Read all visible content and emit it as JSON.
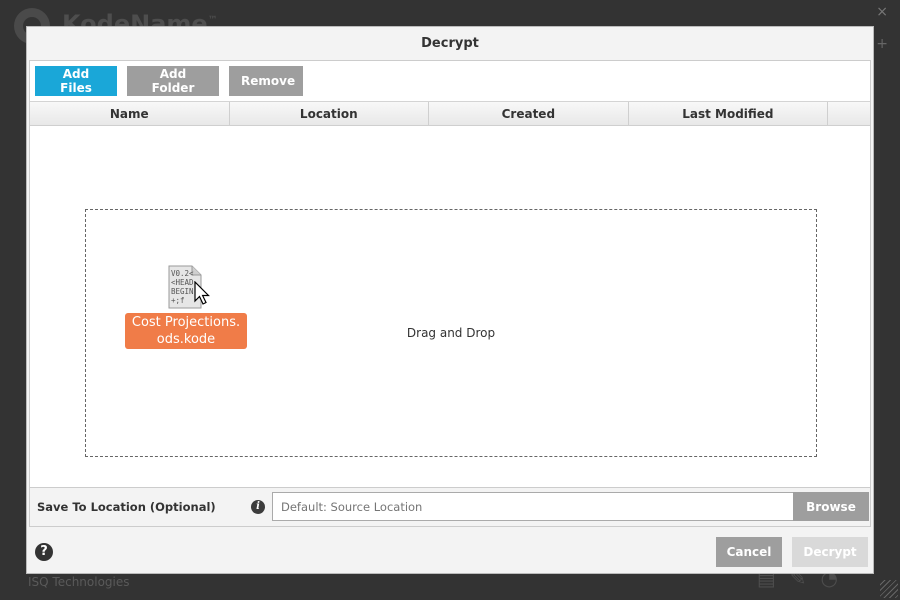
{
  "background": {
    "brand": "KodeName",
    "brand_mark": "™",
    "footer_text": "ISQ Technologies",
    "close_glyph": "×",
    "plus_glyph": "+"
  },
  "dialog": {
    "title": "Decrypt",
    "toolbar": {
      "add_files": "Add Files",
      "add_folder": "Add Folder",
      "remove": "Remove"
    },
    "table": {
      "columns": [
        "Name",
        "Location",
        "Created",
        "Last Modified"
      ]
    },
    "drop_zone": {
      "text": "Drag and Drop",
      "dragged_file": {
        "name_line1": "Cost Projections.",
        "name_line2": "ods.kode",
        "preview_text": "V0.2<\n<HEAD\nBEGIN\n+;f"
      }
    },
    "save_location": {
      "label": "Save To Location (Optional)",
      "info_glyph": "i",
      "placeholder": "Default: Source Location",
      "browse": "Browse"
    },
    "help_glyph": "?",
    "cancel": "Cancel",
    "decrypt": "Decrypt"
  },
  "colors": {
    "primary": "#1aa7d8",
    "grey_button": "#9e9e9e",
    "file_label": "#f07c48",
    "disabled_button": "#d9d9d9"
  }
}
